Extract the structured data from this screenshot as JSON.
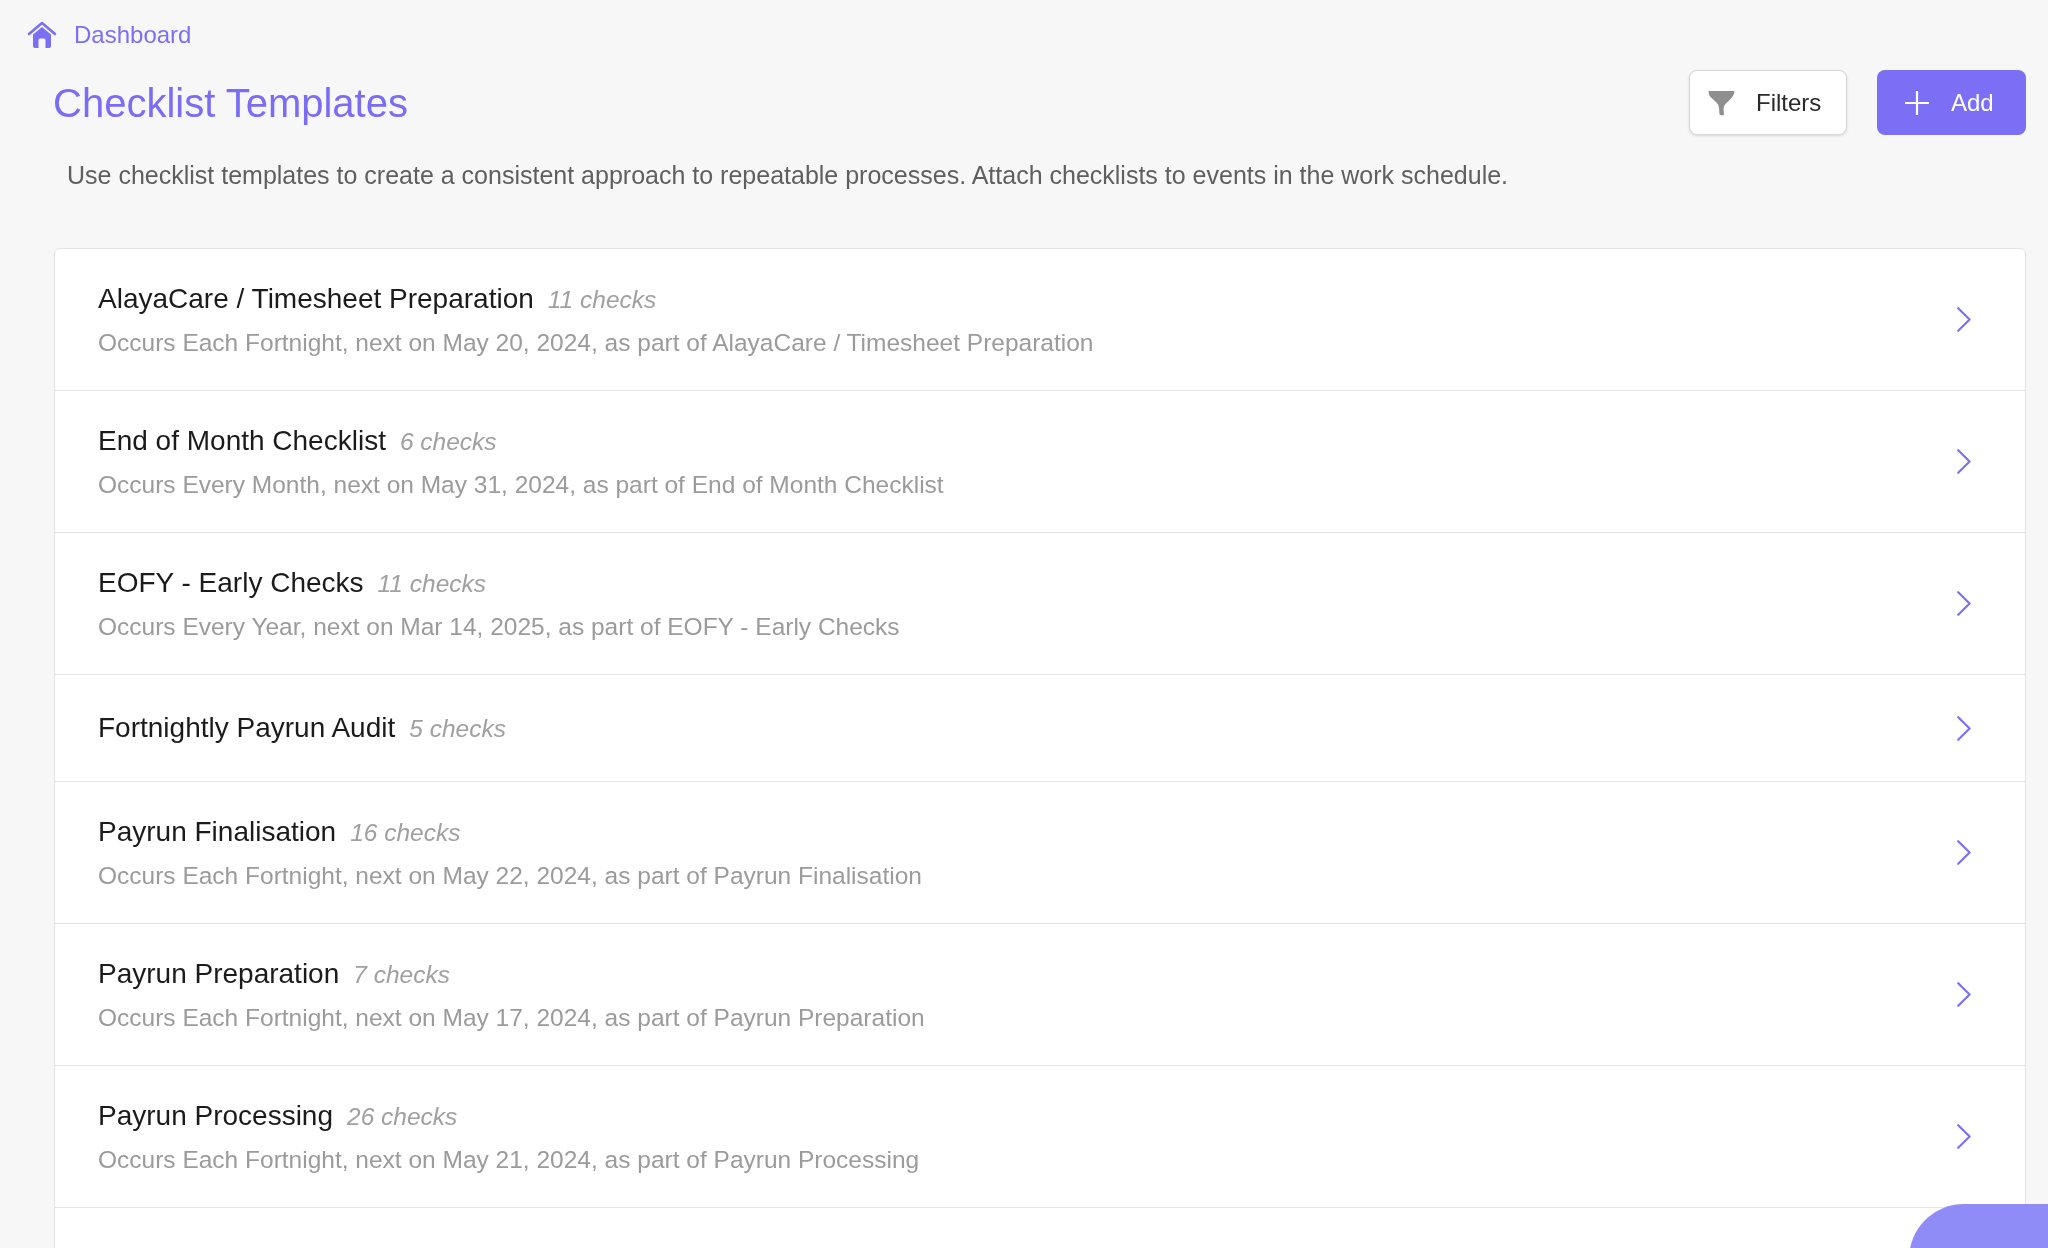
{
  "breadcrumb": {
    "label": "Dashboard"
  },
  "header": {
    "title": "Checklist Templates",
    "buttons": [
      {
        "kind": "filter",
        "label": "Filters"
      },
      {
        "kind": "add",
        "label": "Add"
      }
    ]
  },
  "description": "Use checklist templates to create a consistent approach to repeatable processes. Attach checklists to events in the work schedule.",
  "templates": [
    {
      "name": "AlayaCare / Timesheet Preparation",
      "checks": "11 checks",
      "schedule": "Occurs Each Fortnight, next on May 20, 2024, as part of AlayaCare / Timesheet Preparation"
    },
    {
      "name": "End of Month Checklist",
      "checks": "6 checks",
      "schedule": "Occurs Every Month, next on May 31, 2024, as part of End of Month Checklist"
    },
    {
      "name": "EOFY - Early Checks",
      "checks": "11 checks",
      "schedule": "Occurs Every Year, next on Mar 14, 2025, as part of EOFY - Early Checks"
    },
    {
      "name": "Fortnightly Payrun Audit",
      "checks": "5 checks"
    },
    {
      "name": "Payrun Finalisation",
      "checks": "16 checks",
      "schedule": "Occurs Each Fortnight, next on May 22, 2024, as part of Payrun Finalisation"
    },
    {
      "name": "Payrun Preparation",
      "checks": "7 checks",
      "schedule": "Occurs Each Fortnight, next on May 17, 2024, as part of Payrun Preparation"
    },
    {
      "name": "Payrun Processing",
      "checks": "26 checks",
      "schedule": "Occurs Each Fortnight, next on May 21, 2024, as part of Payrun Processing"
    }
  ]
}
